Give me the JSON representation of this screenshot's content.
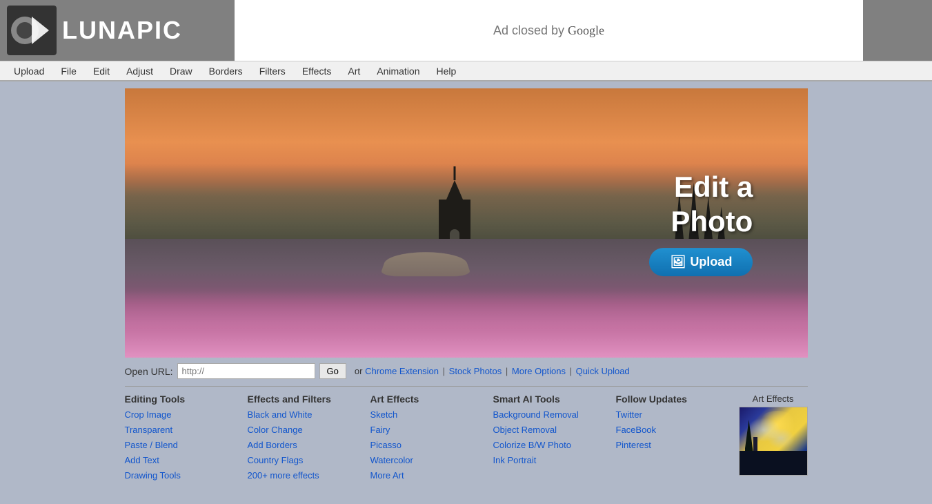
{
  "header": {
    "logo_text": "LUNAPIC",
    "ad_closed": "Ad closed by ",
    "ad_google": "Google"
  },
  "navbar": {
    "items": [
      {
        "label": "Upload",
        "id": "upload"
      },
      {
        "label": "File",
        "id": "file"
      },
      {
        "label": "Edit",
        "id": "edit"
      },
      {
        "label": "Adjust",
        "id": "adjust"
      },
      {
        "label": "Draw",
        "id": "draw"
      },
      {
        "label": "Borders",
        "id": "borders"
      },
      {
        "label": "Filters",
        "id": "filters"
      },
      {
        "label": "Effects",
        "id": "effects"
      },
      {
        "label": "Art",
        "id": "art"
      },
      {
        "label": "Animation",
        "id": "animation"
      },
      {
        "label": "Help",
        "id": "help"
      }
    ]
  },
  "hero": {
    "title_line1": "Edit a",
    "title_line2": "Photo",
    "upload_btn": "Upload"
  },
  "url_bar": {
    "label": "Open URL:",
    "placeholder": "http://",
    "go_btn": "Go",
    "or_text": "or",
    "chrome_extension": "Chrome Extension",
    "stock_photos": "Stock Photos",
    "more_options": "More Options",
    "quick_upload": "Quick Upload"
  },
  "footer": {
    "editing_tools": {
      "title": "Editing Tools",
      "links": [
        "Crop Image",
        "Transparent",
        "Paste / Blend",
        "Add Text",
        "Drawing Tools"
      ]
    },
    "effects_filters": {
      "title": "Effects and Filters",
      "links": [
        "Black and White",
        "Color Change",
        "Add Borders",
        "Country Flags",
        "200+ more effects"
      ]
    },
    "art_effects": {
      "title": "Art Effects",
      "links": [
        "Sketch",
        "Fairy",
        "Picasso",
        "Watercolor",
        "More Art"
      ]
    },
    "smart_ai": {
      "title": "Smart AI Tools",
      "links": [
        "Background Removal",
        "Object Removal",
        "Colorize B/W Photo",
        "Ink Portrait"
      ]
    },
    "follow": {
      "title": "Follow Updates",
      "links": [
        "Twitter",
        "FaceBook",
        "Pinterest"
      ]
    },
    "art_thumb_title": "Art Effects"
  }
}
